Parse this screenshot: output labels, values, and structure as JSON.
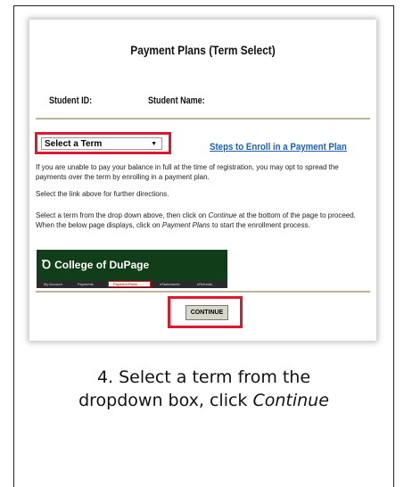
{
  "page": {
    "title": "Payment Plans (Term Select)",
    "student_id_label": "Student ID:",
    "student_name_label": "Student Name:"
  },
  "term_select": {
    "selected": "Select a Term"
  },
  "steps_link": "Steps to Enroll in a Payment Plan",
  "instructions": {
    "p1": "If you are unable to pay your balance in full at the time of registration, you may opt to spread the payments over the term by enrolling in a payment plan.",
    "p2": "Select the link above for further directions.",
    "p3a": "Select a term from the drop down above, then click on ",
    "p3b": "Continue",
    "p3c": " at the bottom of the page to proceed. When the below page displays, click on ",
    "p3d": "Payment Plans",
    "p3e": " to start the enrollment process."
  },
  "banner": {
    "logo_text": "College of DuPage",
    "nav": [
      "My Account",
      "Payments",
      "Payment Plans",
      "eStatements",
      "eRefunds"
    ]
  },
  "continue_button": "CONTINUE",
  "caption": {
    "line1": "4. Select a term from the",
    "line2a": "dropdown box, click ",
    "line2b": "Continue"
  }
}
